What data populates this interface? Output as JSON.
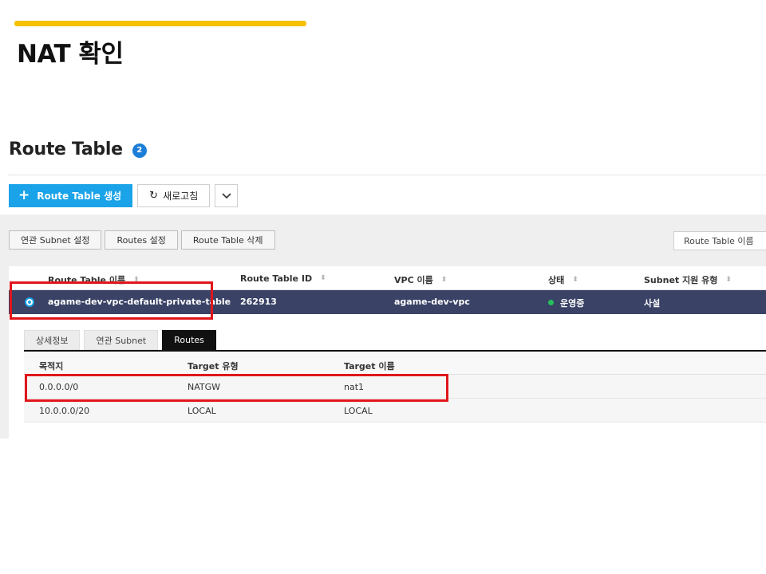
{
  "slide": {
    "title": "NAT 확인",
    "accent_color": "#f6c100"
  },
  "page": {
    "title": "Route Table",
    "count": "2"
  },
  "toolbar": {
    "create_label": "Route Table 생성",
    "refresh_label": "새로고침"
  },
  "actions": {
    "associate_subnet": "연관 Subnet 설정",
    "routes_settings": "Routes 설정",
    "delete": "Route Table 삭제"
  },
  "search": {
    "field_label": "Route Table 이름"
  },
  "table": {
    "columns": [
      "Route Table 이름",
      "Route Table ID",
      "VPC 이름",
      "상태",
      "Subnet 지원 유형"
    ],
    "selected_row": {
      "name": "agame-dev-vpc-default-private-table",
      "id": "262913",
      "vpc": "agame-dev-vpc",
      "status": "운영중",
      "subnet_type": "사설"
    }
  },
  "detail": {
    "tabs": [
      "상세정보",
      "연관 Subnet",
      "Routes"
    ],
    "active_tab": "Routes",
    "routes_columns": [
      "목적지",
      "Target 유형",
      "Target 이름"
    ],
    "routes": [
      {
        "destination": "0.0.0.0/0",
        "target_type": "NATGW",
        "target_name": "nat1"
      },
      {
        "destination": "10.0.0.0/20",
        "target_type": "LOCAL",
        "target_name": "LOCAL"
      }
    ]
  },
  "colors": {
    "primary": "#1aa3e8",
    "selected_row": "#3a4266",
    "highlight": "#e0161b",
    "status_ok": "#22c15e"
  }
}
